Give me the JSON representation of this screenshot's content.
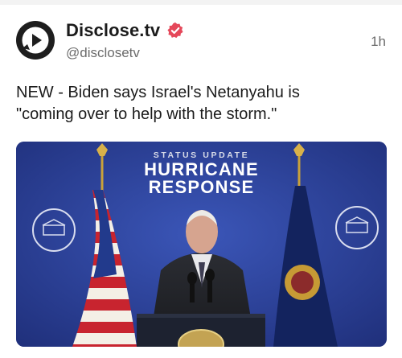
{
  "author": {
    "name": "Disclose.tv",
    "handle": "@disclosetv",
    "avatar_icon": "play-logo-icon",
    "badge_icon": "verified-badge-icon",
    "badge_color": "#e5485a"
  },
  "post": {
    "timestamp": "1h",
    "text": "NEW - Biden says Israel's Netanyahu is\n\"coming over to help with the storm.\""
  },
  "media": {
    "overline": "STATUS UPDATE",
    "headline": "HURRICANE\nRESPONSE",
    "backdrop_color": "#2a3e94"
  }
}
